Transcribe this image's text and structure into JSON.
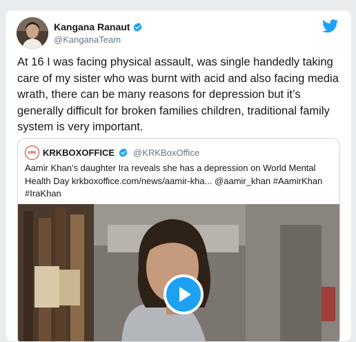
{
  "tweet": {
    "author_name": "Kangana Ranaut",
    "author_handle": "@KanganaTeam",
    "text": "At 16 I was facing physical assault, was single handedly taking care of my sister who was burnt with acid and also facing media wrath, there can be many reasons for depression but it’s generally difficult for broken families children, traditional family system is very important.",
    "verified_icon": "verified-badge-icon",
    "platform_icon": "twitter-bird-icon"
  },
  "quoted": {
    "logo_text": "KRK",
    "author_name": "KRKBOXOFFICE",
    "author_handle": "@KRKBoxOffice",
    "text": "Aamir Khan’s daughter Ira reveals she has a depression on World Mental Health Day krkboxoffice.com/news/aamir-kha... @aamir_khan #AamirKhan #IraKhan",
    "media_icon": "play-icon"
  },
  "colors": {
    "accent": "#1da1f2",
    "text": "#14171a",
    "muted": "#657786",
    "border": "#e1e8ed",
    "brand_red": "#d62828"
  }
}
